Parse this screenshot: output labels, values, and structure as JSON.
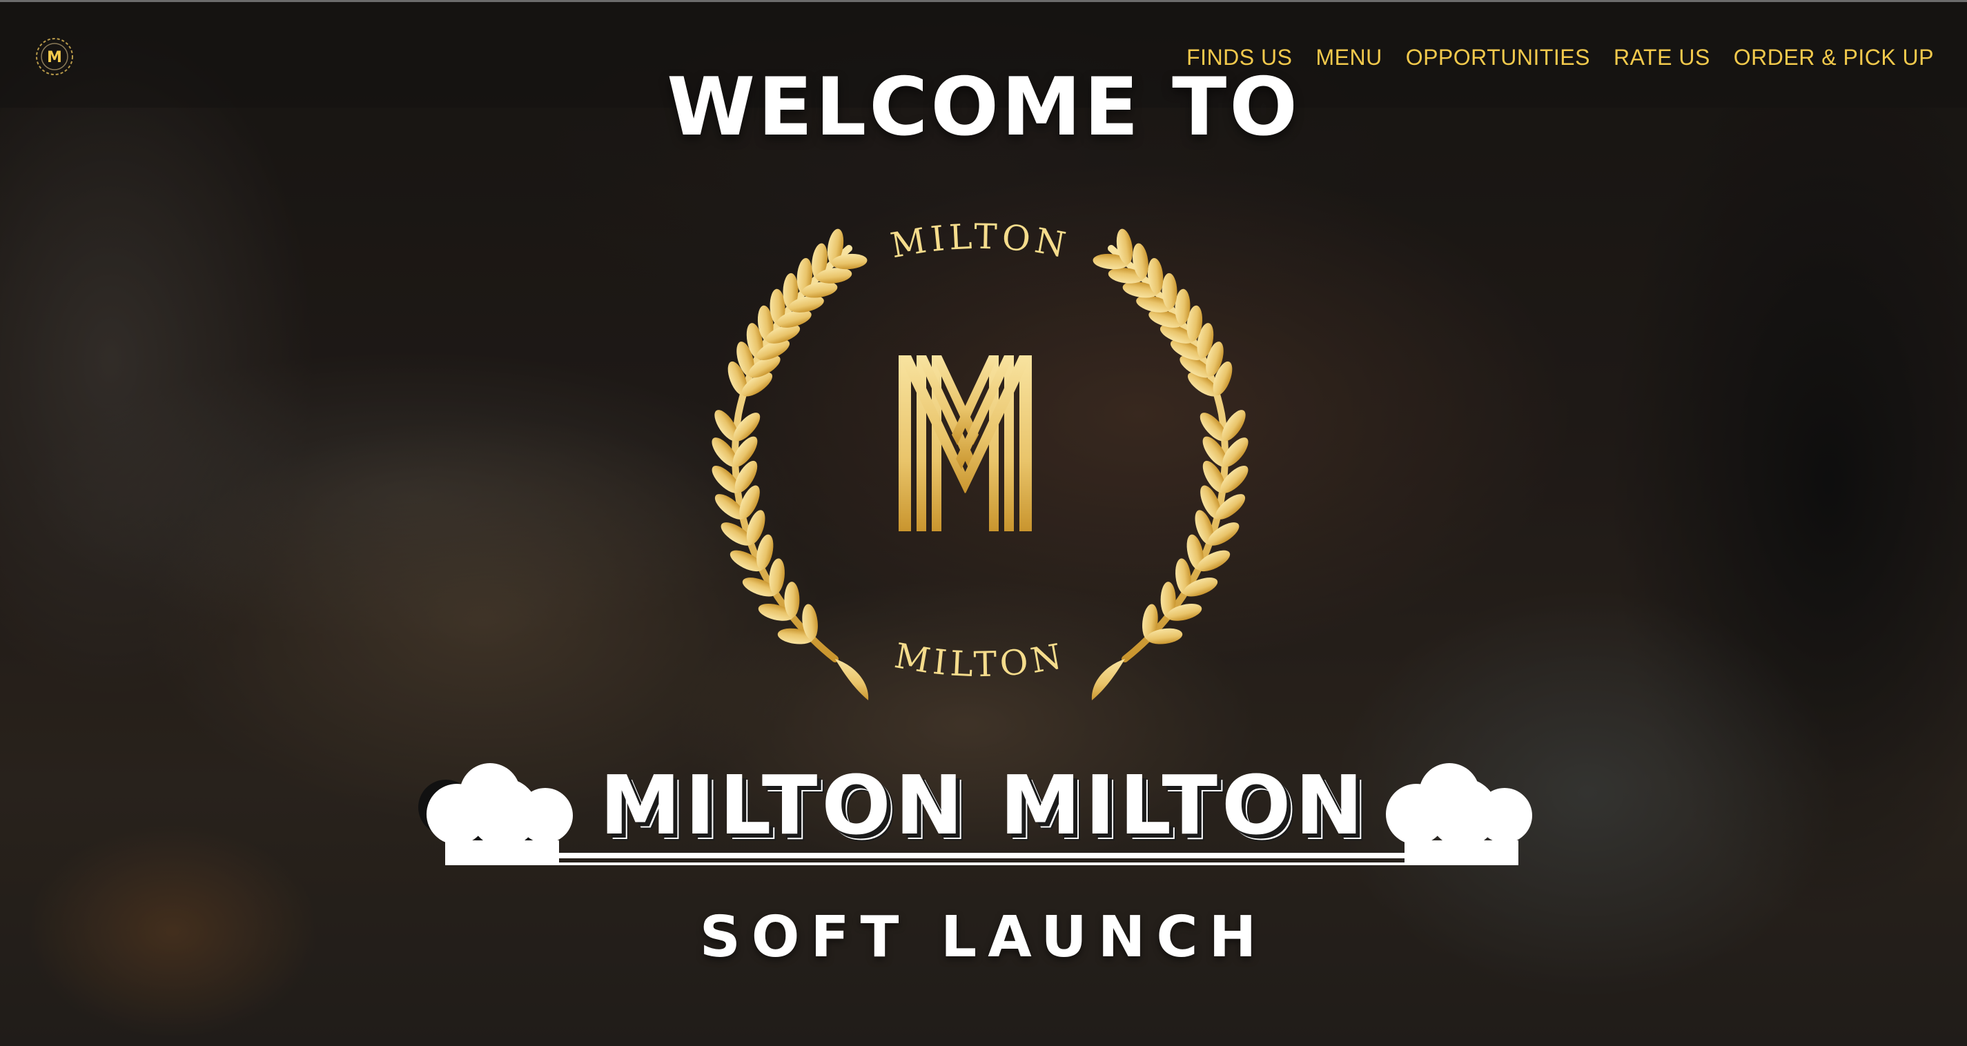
{
  "nav": {
    "logo_icon": "milton-m-logo-icon",
    "links": [
      {
        "label": "FINDS US"
      },
      {
        "label": "MENU"
      },
      {
        "label": "OPPORTUNITIES"
      },
      {
        "label": "RATE US"
      },
      {
        "label": "ORDER & PICK UP"
      }
    ]
  },
  "hero": {
    "welcome": "WELCOME TO",
    "emblem": {
      "top_text": "MILTON",
      "bottom_text": "MILTON",
      "center_letter": "M",
      "icon": "laurel-wreath-icon"
    },
    "title": "MILTON MILTON",
    "subtitle": "SOFT LAUNCH"
  },
  "colors": {
    "accent_gold": "#f2c94c",
    "emblem_gold_light": "#f5dc8c",
    "emblem_gold_dark": "#c9952e",
    "text_white": "#ffffff"
  }
}
